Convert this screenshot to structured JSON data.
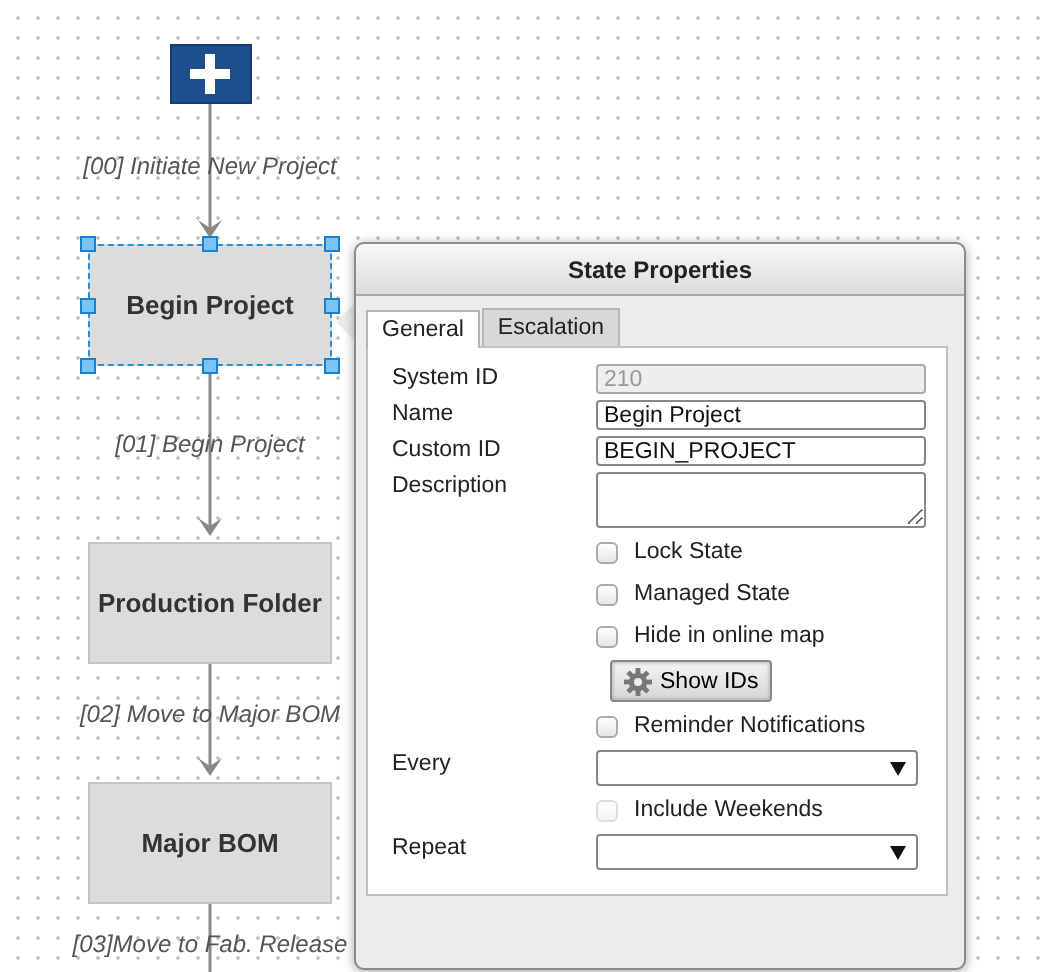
{
  "diagram": {
    "nodes": [
      {
        "kind": "start"
      },
      {
        "kind": "state",
        "label": "Begin Project",
        "selected": true
      },
      {
        "kind": "state",
        "label": "Production Folder",
        "selected": false
      },
      {
        "kind": "state",
        "label": "Major BOM",
        "selected": false
      }
    ],
    "transitions": [
      {
        "label": "[00] Initiate New Project"
      },
      {
        "label": "[01] Begin Project"
      },
      {
        "label": "[02] Move to Major BOM"
      },
      {
        "label": "[03]Move to Fab. Release"
      }
    ]
  },
  "dialog": {
    "title": "State Properties",
    "tabs": [
      {
        "label": "General",
        "selected": true
      },
      {
        "label": "Escalation",
        "selected": false
      }
    ],
    "fields": [
      {
        "kind": "text",
        "label": "System ID",
        "value": "210",
        "disabled": true
      },
      {
        "kind": "text",
        "label": "Name",
        "value": "Begin Project",
        "disabled": false
      },
      {
        "kind": "text",
        "label": "Custom ID",
        "value": "BEGIN_PROJECT",
        "disabled": false
      },
      {
        "kind": "textarea",
        "label": "Description"
      },
      {
        "kind": "checkbox",
        "label": "Lock State",
        "checked": false,
        "disabled": false
      },
      {
        "kind": "checkbox",
        "label": "Managed State",
        "checked": false,
        "disabled": false
      },
      {
        "kind": "checkbox",
        "label": "Hide in online map",
        "checked": false,
        "disabled": false
      },
      {
        "kind": "button",
        "label": "Show IDs"
      },
      {
        "kind": "checkbox",
        "label": "Reminder Notifications",
        "checked": false,
        "disabled": false
      },
      {
        "kind": "select",
        "label": "Every"
      },
      {
        "kind": "checkbox",
        "label": "Include Weekends",
        "checked": false,
        "disabled": true
      },
      {
        "kind": "select",
        "label": "Repeat"
      }
    ]
  }
}
